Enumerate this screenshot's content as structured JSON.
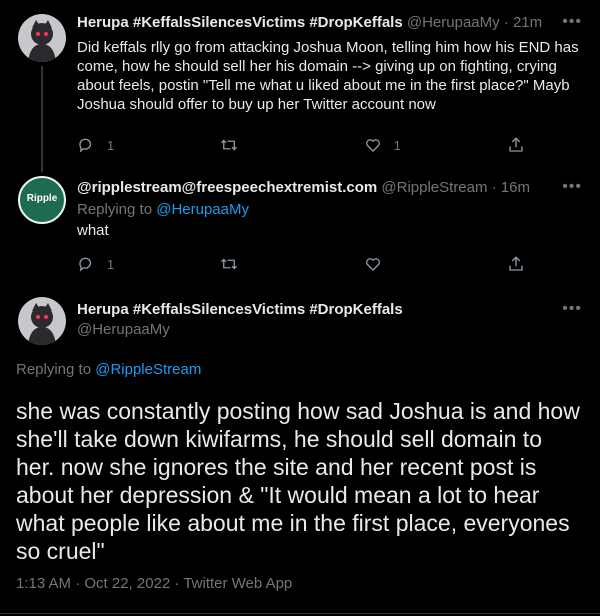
{
  "tweet1": {
    "display_name": "Herupa #KeffalsSilencesVictims #DropKeffals",
    "handle": "@HerupaaMy",
    "separator": "·",
    "time": "21m",
    "text": "Did keffals rlly go from attacking Joshua Moon, telling him how his END has come, how he should sell her his domain --> giving up on fighting, crying about feels, postin \"Tell me what u liked about me in the first place?\" Mayb Joshua should offer to buy up her Twitter account now",
    "reply_count": "1",
    "retweet_count": "",
    "like_count": "1"
  },
  "tweet2": {
    "display_name": "@ripplestream@freespeechextremist.com",
    "handle": "@RippleStream",
    "separator": "·",
    "time": "16m",
    "replying_prefix": "Replying to",
    "replying_to": "@HerupaaMy",
    "text": "what",
    "avatar_label": "Ripple",
    "reply_count": "1",
    "retweet_count": "",
    "like_count": ""
  },
  "tweet3": {
    "display_name": "Herupa #KeffalsSilencesVictims #DropKeffals",
    "handle": "@HerupaaMy",
    "replying_prefix": "Replying to",
    "replying_to": "@RippleStream",
    "text": "she was constantly posting how sad Joshua is and how she'll take down kiwifarms, he should sell domain to her. now she ignores the site and her recent post is about her depression & \"It would mean a lot to hear what people like about me in the first place, everyones so cruel\"",
    "timestamp": "1:13 AM · Oct 22, 2022 · Twitter Web App"
  },
  "icons": {
    "more": "more-horizontal-icon",
    "reply": "reply-icon",
    "retweet": "retweet-icon",
    "like": "heart-icon",
    "share": "share-icon"
  },
  "colors": {
    "background": "#000000",
    "text": "#e7e9ea",
    "muted": "#71767b",
    "link": "#1d9bf0"
  }
}
